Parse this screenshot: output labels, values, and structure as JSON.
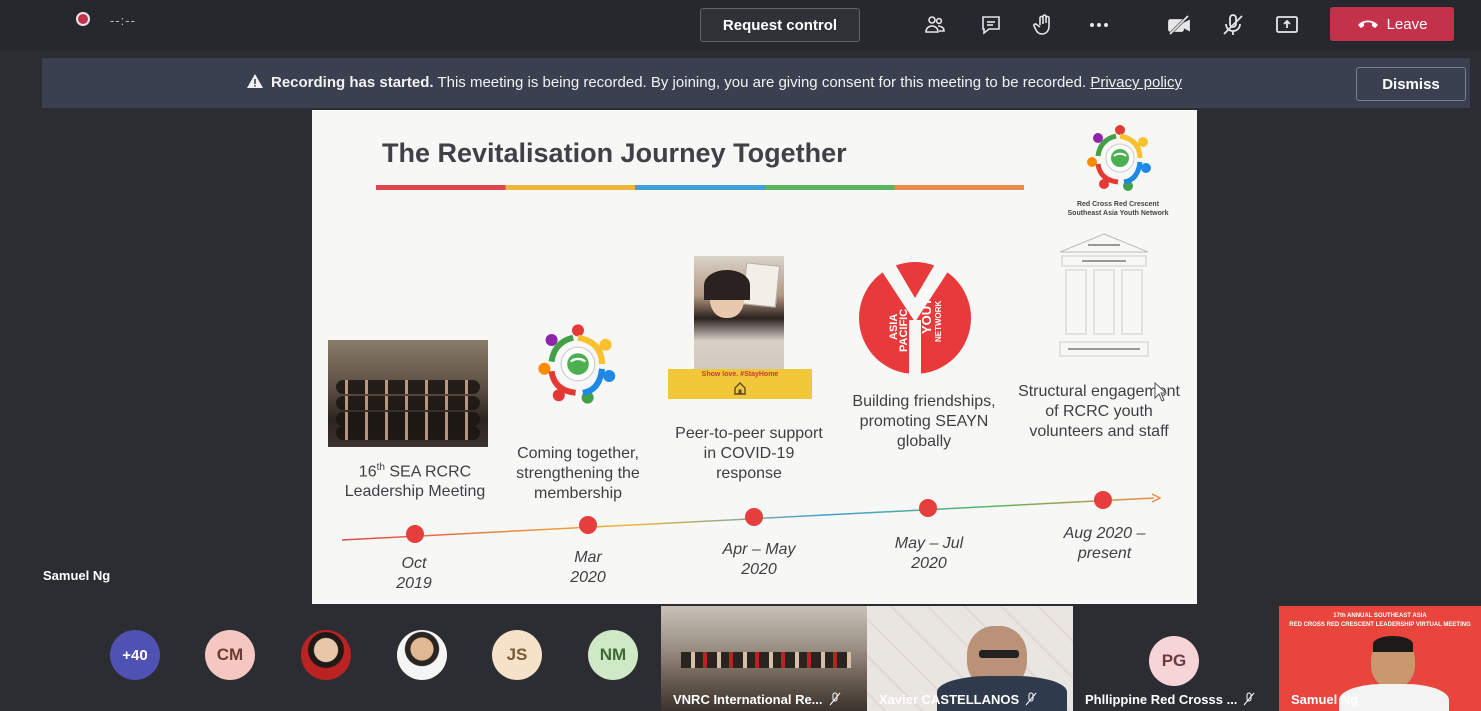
{
  "topbar": {
    "timer": "--:--",
    "request_control": "Request control",
    "leave_label": "Leave",
    "icons": [
      "participants-icon",
      "chat-icon",
      "raise-hand-icon",
      "more-icon",
      "camera-off-icon",
      "mic-off-icon",
      "share-icon",
      "phone-hangup-icon"
    ]
  },
  "banner": {
    "bold": "Recording has started.",
    "text": " This meeting is being recorded. By joining, you are giving consent for this meeting to be recorded. ",
    "link": "Privacy policy",
    "dismiss": "Dismiss"
  },
  "slide": {
    "title": "The Revitalisation Journey Together",
    "org_line1": "Red Cross Red Crescent",
    "org_line2": "Southeast Asia Youth Network",
    "covid_tag": "Show love. #StayHome",
    "apyn_text_a": "ASIA",
    "apyn_text_b": "PACIFIC",
    "apyn_text_c": "YOUTH",
    "apyn_text_d": "NETWORK",
    "milestones": [
      {
        "caption_sup": "th",
        "caption_pre": "16",
        "caption": " SEA RCRC Leadership Meeting",
        "date_a": "Oct",
        "date_b": "2019"
      },
      {
        "caption": "Coming together, strengthening the membership",
        "date_a": "Mar",
        "date_b": "2020"
      },
      {
        "caption": "Peer-to-peer support in COVID-19 response",
        "date_a": "Apr – May",
        "date_b": "2020"
      },
      {
        "caption": "Building friendships, promoting SEAYN globally",
        "date_a": "May – Jul",
        "date_b": "2020"
      },
      {
        "caption": "Structural engagement of RCRC youth volunteers and staff",
        "date_a": "Aug 2020 –",
        "date_b": "present"
      }
    ]
  },
  "presenter": "Samuel Ng",
  "participants": {
    "overflow": "+40",
    "avatars": [
      {
        "initials": "CM",
        "bg": "#f4c7c0",
        "fg": "#6b3b33"
      },
      {
        "initials": "JS",
        "bg": "#f6e2c8",
        "fg": "#7a5a35"
      },
      {
        "initials": "NM",
        "bg": "#cfe8c6",
        "fg": "#3f6a35"
      },
      {
        "initials": "PG",
        "bg": "#f7d4d6",
        "fg": "#6b3b40"
      }
    ],
    "tiles": [
      {
        "label": "VNRC International Re..."
      },
      {
        "label": "Xavier CASTELLANOS"
      },
      {
        "label": "Phllippine Red Crosss ..."
      },
      {
        "label": "Samuel Ng"
      }
    ],
    "event_banner_line1": "17th ANNUAL SOUTHEAST ASIA",
    "event_banner_line2": "RED CROSS RED CRESCENT LEADERSHIP VIRTUAL MEETING"
  },
  "colors": {
    "accent_red": "#c4314b",
    "overflow_bg": "#4f52b2"
  }
}
